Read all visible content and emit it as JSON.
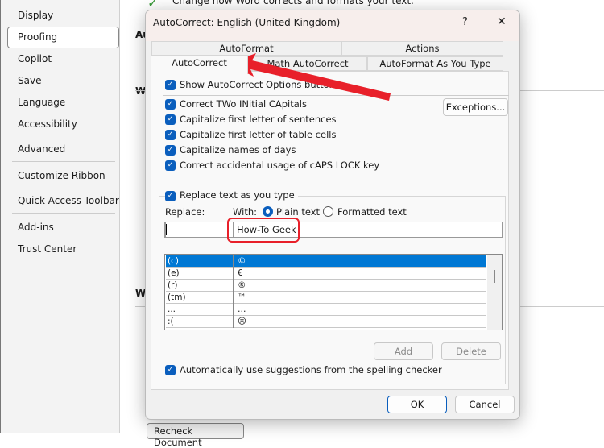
{
  "sidebar": {
    "items": [
      {
        "label": "Display"
      },
      {
        "label": "Proofing",
        "selected": true
      },
      {
        "label": "Copilot"
      },
      {
        "label": "Save"
      },
      {
        "label": "Language"
      },
      {
        "label": "Accessibility"
      },
      {
        "label": "Advanced"
      },
      {
        "label": "Customize Ribbon"
      },
      {
        "label": "Quick Access Toolbar"
      },
      {
        "label": "Add-ins"
      },
      {
        "label": "Trust Center"
      }
    ]
  },
  "background": {
    "description": "Change how Word corrects and formats your text.",
    "heading1": "Au",
    "heading2": "W",
    "heading3": "W",
    "recheck_button": "Recheck Document"
  },
  "dialog": {
    "title": "AutoCorrect: English (United Kingdom)",
    "help": "?",
    "close": "✕",
    "tabs_row1": [
      "AutoFormat",
      "Actions"
    ],
    "tabs_row2": [
      "AutoCorrect",
      "Math AutoCorrect",
      "AutoFormat As You Type"
    ],
    "active_tab": "AutoCorrect",
    "show_options": "Show AutoCorrect Options buttons",
    "options": [
      "Correct TWo INitial CApitals",
      "Capitalize first letter of sentences",
      "Capitalize first letter of table cells",
      "Capitalize names of days",
      "Correct accidental usage of cAPS LOCK key"
    ],
    "exceptions": "Exceptions...",
    "replace_as_type": "Replace text as you type",
    "replace_label": "Replace:",
    "with_label": "With:",
    "plain_text": "Plain text",
    "formatted_text": "Formatted text",
    "with_selected": "Plain text",
    "replace_value": "",
    "with_value": "How-To Geek",
    "entries": [
      {
        "from": "(c)",
        "to": "©"
      },
      {
        "from": "(e)",
        "to": "€"
      },
      {
        "from": "(r)",
        "to": "®"
      },
      {
        "from": "(tm)",
        "to": "™"
      },
      {
        "from": "...",
        "to": "…"
      },
      {
        "from": ":(",
        "to": "☹"
      }
    ],
    "add": "Add",
    "delete": "Delete",
    "auto_suggest": "Automatically use suggestions from the spelling checker",
    "ok": "OK",
    "cancel": "Cancel"
  },
  "colors": {
    "accent": "#0a5ebd",
    "selection": "#0078d4",
    "annotation": "#e8202a"
  }
}
